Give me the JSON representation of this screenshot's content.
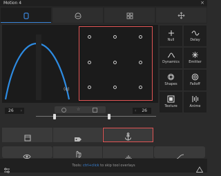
{
  "window": {
    "title": "Motion 4",
    "close_label": "×"
  },
  "tabs": [
    "shape",
    "blob",
    "grid",
    "move"
  ],
  "slider": {
    "left_value": "26",
    "right_value": "26",
    "value_label": "(q)"
  },
  "tools": [
    {
      "id": "null",
      "label": "Null"
    },
    {
      "id": "delay",
      "label": "Delay"
    },
    {
      "id": "dynamics",
      "label": "Dynamics"
    },
    {
      "id": "emitter",
      "label": "Emitter"
    },
    {
      "id": "shapes",
      "label": "Shapes"
    },
    {
      "id": "falloff",
      "label": "Falloff"
    },
    {
      "id": "texture",
      "label": "Texture"
    },
    {
      "id": "anime",
      "label": "Anime"
    }
  ],
  "status": {
    "pre": "Tools:",
    "mod": "ctrl+click",
    "post": "to skip tool overlays"
  },
  "colors": {
    "accent": "#3a84d8",
    "highlight": "#e25555"
  }
}
